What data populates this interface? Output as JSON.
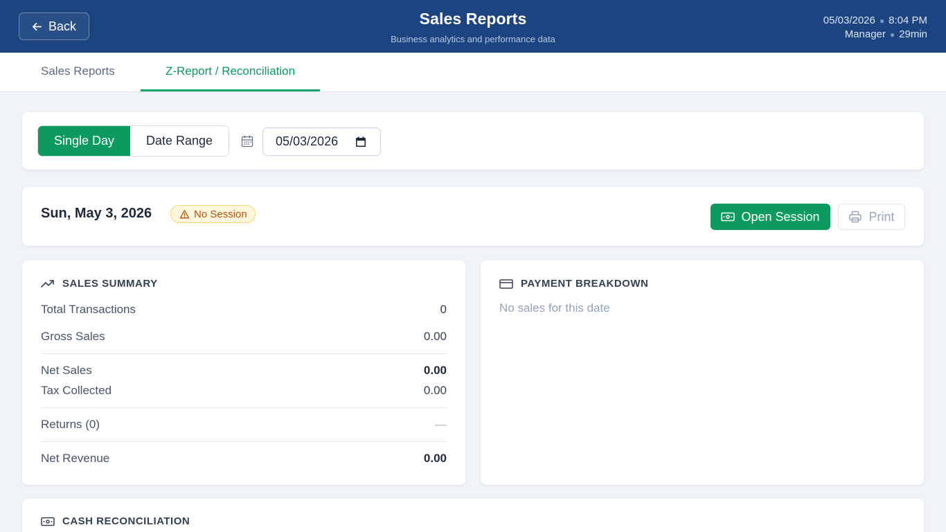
{
  "header": {
    "back_label": "Back",
    "title": "Sales Reports",
    "subtitle": "Business analytics and performance data",
    "date": "05/03/2026",
    "time": "8:04 PM",
    "role": "Manager",
    "duration": "29min"
  },
  "tabs": [
    {
      "label": "Sales Reports",
      "active": false
    },
    {
      "label": "Z-Report / Reconciliation",
      "active": true
    }
  ],
  "filter": {
    "modes": [
      "Single Day",
      "Date Range"
    ],
    "selected_mode": "Single Day",
    "date_value": "05/03/2026"
  },
  "session": {
    "date_title": "Sun, May 3, 2026",
    "status_badge": "No Session",
    "open_label": "Open Session",
    "print_label": "Print"
  },
  "sales_summary": {
    "title": "SALES SUMMARY",
    "rows": [
      {
        "label": "Total Transactions",
        "value": "0"
      },
      {
        "label": "Gross Sales",
        "value": "0.00"
      },
      {
        "label": "Net Sales",
        "value": "0.00"
      },
      {
        "label": "Tax Collected",
        "value": "0.00"
      },
      {
        "label": "Returns (0)",
        "value": "—"
      },
      {
        "label": "Net Revenue",
        "value": "0.00"
      }
    ]
  },
  "payment_breakdown": {
    "title": "PAYMENT BREAKDOWN",
    "empty_text": "No sales for this date"
  },
  "cash_reconciliation": {
    "title": "CASH RECONCILIATION"
  },
  "colors": {
    "header_bg": "#1c4480",
    "accent_green": "#0c9a5e",
    "warning_bg": "#fef6dc",
    "warning_text": "#b45309",
    "page_bg": "#f0f3f7"
  },
  "icons": {
    "back": "arrow-left-icon",
    "calendar": "calendar-icon",
    "picker": "calendar-picker-icon",
    "warning": "warning-triangle-icon",
    "open_session": "banknote-icon",
    "print": "printer-icon",
    "sales_summary": "trending-up-icon",
    "payment_breakdown": "credit-card-icon",
    "cash_reconciliation": "banknote-icon"
  }
}
